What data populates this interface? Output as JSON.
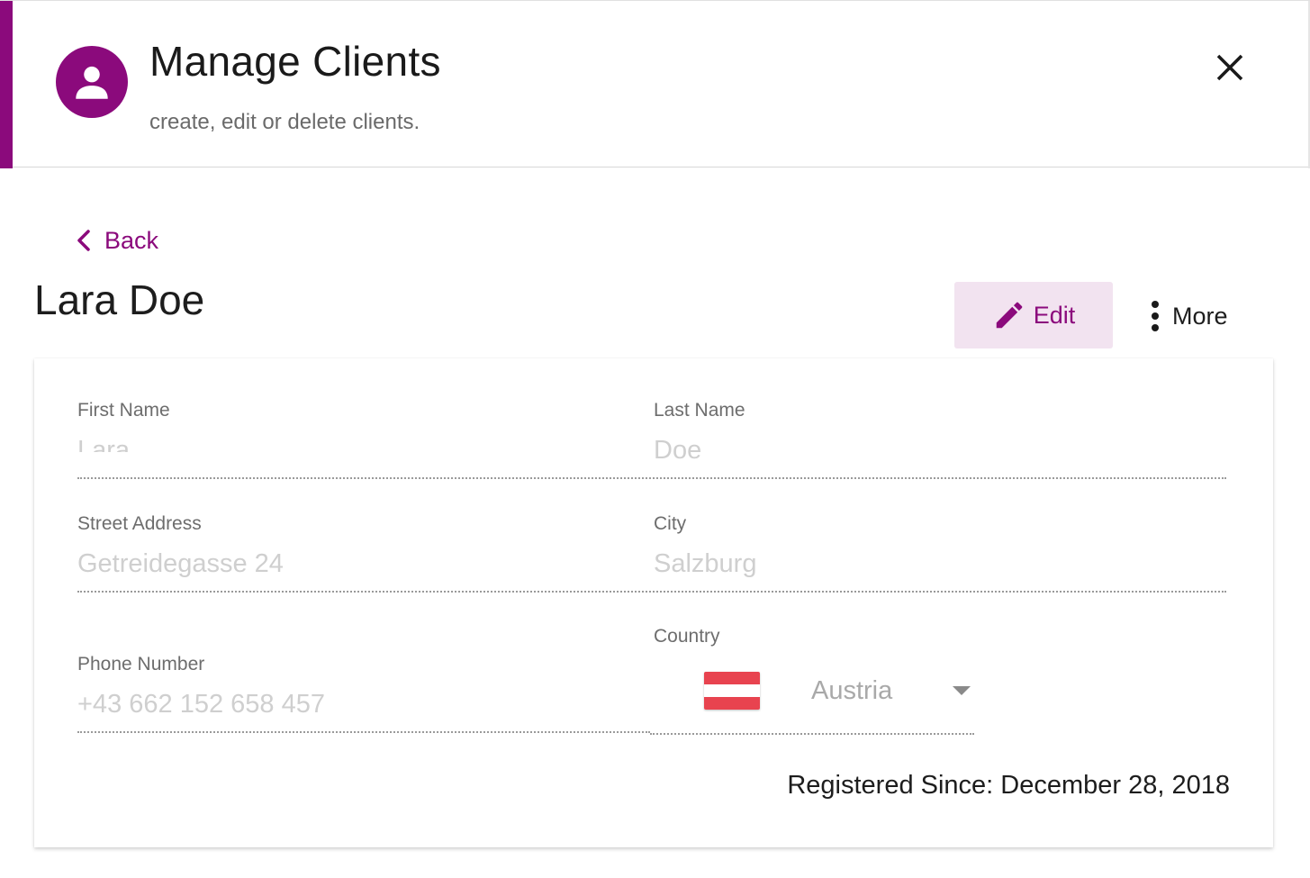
{
  "colors": {
    "accent": "#8b0a7c",
    "accent_light": "#f2e3f0",
    "flag_red": "#e8434f",
    "flag_white": "#ffffff"
  },
  "header": {
    "title": "Manage Clients",
    "subtitle": "create, edit or delete clients.",
    "avatar_icon": "person-icon",
    "close_icon": "close-icon"
  },
  "nav": {
    "back_label": "Back",
    "back_icon": "chevron-left-icon"
  },
  "client": {
    "name": "Lara Doe"
  },
  "actions": {
    "edit_label": "Edit",
    "edit_icon": "pencil-icon",
    "more_label": "More",
    "more_icon": "more-vertical-icon"
  },
  "form": {
    "first_name_label": "First Name",
    "first_name_value": "Lara",
    "last_name_label": "Last Name",
    "last_name_value": "Doe",
    "street_label": "Street Address",
    "street_value": "Getreidegasse 24",
    "city_label": "City",
    "city_value": "Salzburg",
    "phone_label": "Phone Number",
    "phone_value": "+43 662 152 658 457",
    "country_label": "Country",
    "country_value": "Austria",
    "country_flag_icon": "austria-flag-icon",
    "dropdown_icon": "caret-down-icon"
  },
  "registered": "Registered Since: December 28, 2018"
}
